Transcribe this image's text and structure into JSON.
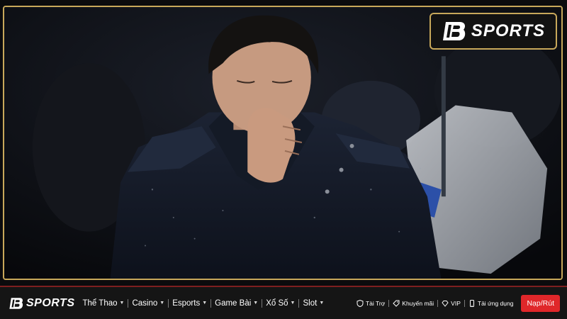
{
  "brand": {
    "name": "SPORTS",
    "accent": "#c8a85a",
    "cta_color": "#e0272a"
  },
  "nav": {
    "menu": [
      {
        "label": "Thể Thao"
      },
      {
        "label": "Casino"
      },
      {
        "label": "Esports"
      },
      {
        "label": "Game Bài"
      },
      {
        "label": "Xổ Số"
      },
      {
        "label": "Slot"
      }
    ],
    "links": [
      {
        "label": "Tài Trợ",
        "icon": "shield-icon"
      },
      {
        "label": "Khuyến mãi",
        "icon": "tag-icon"
      },
      {
        "label": "VIP",
        "icon": "diamond-icon"
      },
      {
        "label": "Tải ứng dụng",
        "icon": "phone-icon"
      }
    ],
    "deposit_label": "Nạp/Rút"
  }
}
